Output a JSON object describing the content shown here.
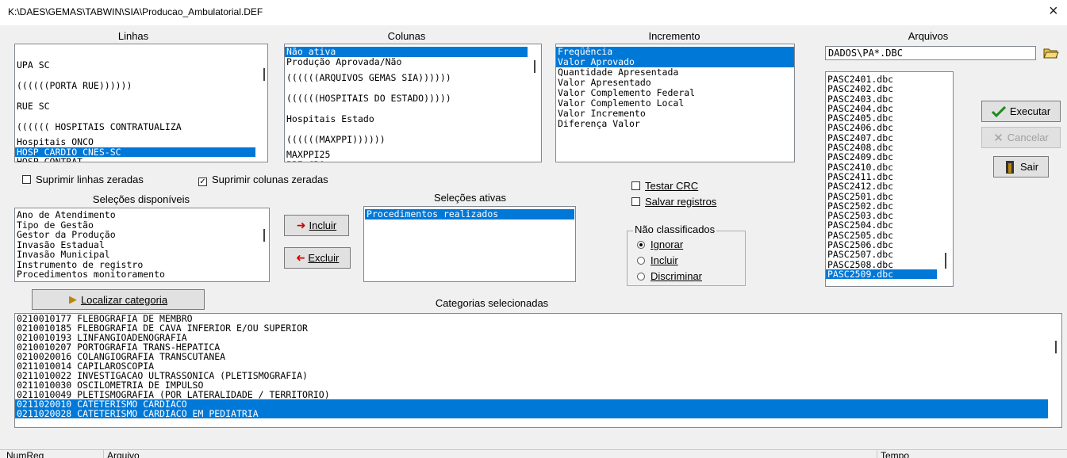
{
  "window": {
    "title": "K:\\DAES\\GEMAS\\TABWIN\\SIA\\Producao_Ambulatorial.DEF",
    "close": "×"
  },
  "linhas": {
    "header": "Linhas",
    "items": [
      "UPA SC",
      "((((((PORTA RUE))))))",
      "RUE SC",
      "(((((( HOSPITAIS CONTRATUALIZA",
      "Hospitais ONCO",
      "HOSP CARDIO CNES-SC",
      "HOSP CONTRAT"
    ],
    "selected_index": 5
  },
  "colunas": {
    "header": "Colunas",
    "items": [
      "Não ativa",
      "Produção Aprovada/Não",
      "((((((ARQUIVOS GEMAS SIA))))))",
      "((((((HOSPITAIS DO ESTADO)))))",
      "Hospitais Estado",
      "((((((MAXPPI))))))",
      "MAXPPI25",
      "PPI CRO"
    ],
    "selected_index": 0
  },
  "incremento": {
    "header": "Incremento",
    "items": [
      "Freqüência",
      "Valor Aprovado",
      "Quantidade Apresentada",
      "Valor Apresentado",
      "Valor Complemento Federal",
      "Valor Complemento Local",
      "Valor Incremento",
      "Diferença Valor"
    ],
    "selected": [
      0,
      1
    ]
  },
  "arquivos": {
    "header": "Arquivos",
    "path": "DADOS\\PA*.DBC",
    "open_icon": "folder-open-icon",
    "files": [
      "PASC2401.dbc",
      "PASC2402.dbc",
      "PASC2403.dbc",
      "PASC2404.dbc",
      "PASC2405.dbc",
      "PASC2406.dbc",
      "PASC2407.dbc",
      "PASC2408.dbc",
      "PASC2409.dbc",
      "PASC2410.dbc",
      "PASC2411.dbc",
      "PASC2412.dbc",
      "PASC2501.dbc",
      "PASC2502.dbc",
      "PASC2503.dbc",
      "PASC2504.dbc",
      "PASC2505.dbc",
      "PASC2506.dbc",
      "PASC2507.dbc",
      "PASC2508.dbc",
      "PASC2509.dbc"
    ],
    "selected_index": 20
  },
  "options": {
    "suprimir_linhas": {
      "label": "Suprimir linhas zeradas",
      "checked": false
    },
    "suprimir_colunas": {
      "label": "Suprimir colunas zeradas",
      "checked": true
    },
    "testar_crc": {
      "label": "Testar CRC",
      "checked": false
    },
    "salvar_registros": {
      "label": "Salvar registros",
      "checked": false
    }
  },
  "selecoes_disponiveis": {
    "header": "Seleções disponíveis",
    "items": [
      "Ano de Atendimento",
      "Tipo de Gestão",
      "Gestor da Produção",
      "Invasão Estadual",
      "Invasão Municipal",
      "Instrumento de registro",
      "Procedimentos monitoramento"
    ]
  },
  "selecoes_ativas": {
    "header": "Seleções ativas",
    "items": [
      "Procedimentos realizados"
    ],
    "selected_index": 0
  },
  "buttons": {
    "incluir": "Incluir",
    "excluir": "Excluir",
    "executar": "Executar",
    "cancelar": "Cancelar",
    "sair": "Sair",
    "localizar": "Localizar categoria"
  },
  "nao_classificados": {
    "legend": "Não classificados",
    "options": [
      "Ignorar",
      "Incluir",
      "Discriminar"
    ],
    "selected_index": 0
  },
  "categorias": {
    "header": "Categorias selecionadas",
    "items": [
      "0210010177 FLEBOGRAFIA DE MEMBRO",
      "0210010185 FLEBOGRAFIA DE CAVA INFERIOR E/OU SUPERIOR",
      "0210010193 LINFANGIOADENOGRAFIA",
      "0210010207 PORTOGRAFIA TRANS-HEPATICA",
      "0210020016 COLANGIOGRAFIA TRANSCUTANEA",
      "0211010014 CAPILAROSCOPIA",
      "0211010022 INVESTIGACAO ULTRASSONICA (PLETISMOGRAFIA)",
      "0211010030 OSCILOMETRIA DE IMPULSO",
      "0211010049 PLETISMOGRAFIA (POR LATERALIDADE / TERRITORIO)",
      "0211020010 CATETERISMO CARDIACO",
      "0211020028 CATETERISMO CARDIACO EM PEDIATRIA"
    ],
    "selected": [
      9,
      10
    ]
  },
  "statusbar": {
    "numreg": "NumReg",
    "arquivo": "Arquivo",
    "tempo": "Tempo"
  },
  "colors": {
    "selection": "#0078d7",
    "executar_check": "#1e8a1e",
    "arrow": "#d40000"
  }
}
